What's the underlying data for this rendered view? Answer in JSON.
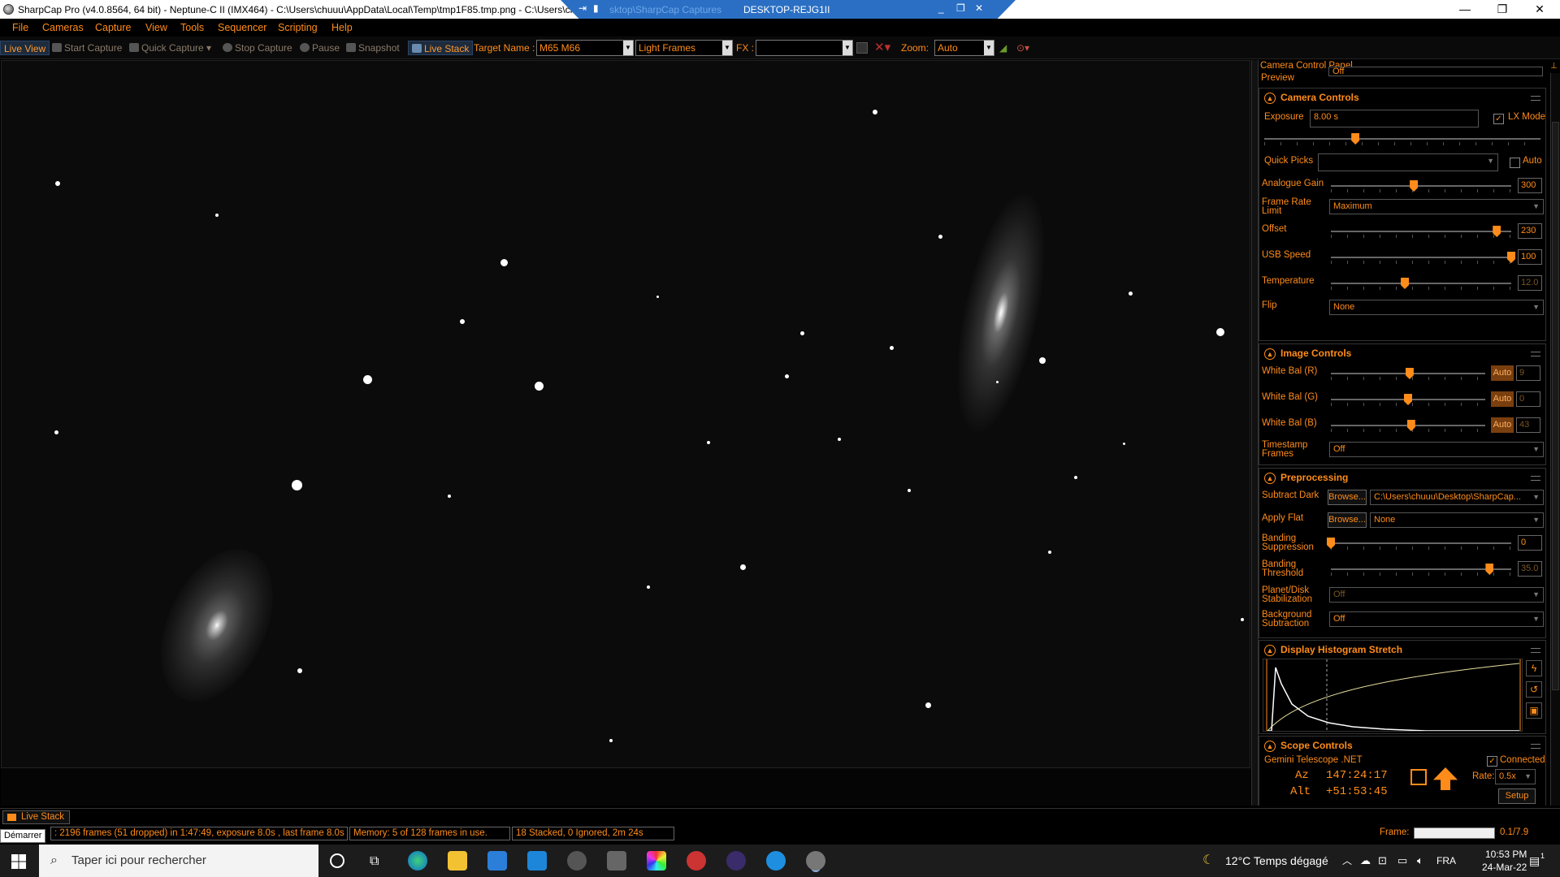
{
  "window": {
    "title": "SharpCap Pro (v4.0.8564, 64 bit) - Neptune-C II (IMX464) - C:\\Users\\chuuu\\AppData\\Local\\Temp\\tmp1F85.tmp.png - C:\\Users\\ch",
    "remote_title": "DESKTOP-REJG1II",
    "remote_faded": "sktop\\SharpCap Captures"
  },
  "menu": [
    "File",
    "Cameras",
    "Capture",
    "View",
    "Tools",
    "Sequencer",
    "Scripting",
    "Help"
  ],
  "toolbar": {
    "live_view": "Live View",
    "start_capture": "Start Capture",
    "quick_capture": "Quick Capture",
    "stop_capture": "Stop Capture",
    "pause": "Pause",
    "snapshot": "Snapshot",
    "live_stack": "Live Stack",
    "target_name_label": "Target Name :",
    "target_name_value": "M65 M66",
    "frame_type": "Light Frames",
    "fx_label": "FX :",
    "fx_value": "",
    "zoom_label": "Zoom:",
    "zoom_value": "Auto"
  },
  "panel": {
    "title": "Camera Control Panel",
    "preview_label": "Preview",
    "preview_value": "Off",
    "camera_controls": {
      "header": "Camera Controls",
      "exposure_label": "Exposure",
      "exposure_value": "8.00 s",
      "lx_mode_label": "LX Mode",
      "lx_mode_checked": true,
      "exposure_slider": 0.33,
      "quick_picks_label": "Quick Picks",
      "quick_picks_value": "",
      "auto_label": "Auto",
      "analogue_gain_label": "Analogue Gain",
      "analogue_gain_value": "300",
      "analogue_gain_slider": 0.46,
      "frame_rate_label": "Frame Rate Limit",
      "frame_rate_value": "Maximum",
      "offset_label": "Offset",
      "offset_value": "230",
      "offset_slider": 0.92,
      "usb_speed_label": "USB Speed",
      "usb_speed_value": "100",
      "usb_speed_slider": 1.0,
      "temperature_label": "Temperature",
      "temperature_value": "12.0",
      "temperature_slider": 0.41,
      "flip_label": "Flip",
      "flip_value": "None"
    },
    "image_controls": {
      "header": "Image Controls",
      "wb_r_label": "White Bal (R)",
      "wb_r_value": "9",
      "wb_r_slider": 0.51,
      "wb_g_label": "White Bal (G)",
      "wb_g_value": "0",
      "wb_g_slider": 0.5,
      "wb_b_label": "White Bal (B)",
      "wb_b_value": "43",
      "wb_b_slider": 0.52,
      "auto_label": "Auto",
      "timestamp_label": "Timestamp Frames",
      "timestamp_value": "Off"
    },
    "preprocessing": {
      "header": "Preprocessing",
      "subtract_dark_label": "Subtract Dark",
      "browse_label": "Browse...",
      "subtract_dark_value": "C:\\Users\\chuuu\\Desktop\\SharpCap...",
      "apply_flat_label": "Apply Flat",
      "apply_flat_value": "None",
      "banding_supp_label": "Banding Suppression",
      "banding_supp_value": "0",
      "banding_supp_slider": 0.0,
      "banding_thresh_label": "Banding Threshold",
      "banding_thresh_value": "35.0",
      "banding_thresh_slider": 0.88,
      "planet_label": "Planet/Disk Stabilization",
      "planet_value": "Off",
      "background_label": "Background Subtraction",
      "background_value": "Off"
    },
    "histogram": {
      "header": "Display Histogram Stretch"
    },
    "scope": {
      "header": "Scope Controls",
      "mount_name": "Gemini Telescope .NET",
      "connected_label": "Connected",
      "connected": true,
      "az_label": "Az",
      "az_value": "147:24:17",
      "alt_label": "Alt",
      "alt_value": "+51:53:45",
      "rate_label": "Rate:",
      "rate_value": "0.5x",
      "setup_label": "Setup"
    }
  },
  "tab": {
    "live_stack": "Live Stack"
  },
  "status": {
    "tooltip": "Démarrer",
    "frames": ": 2196 frames (51 dropped) in 1:47:49, exposure 8.0s , last frame 8.0s",
    "memory": "Memory: 5 of 128 frames in use.",
    "stacked": "18 Stacked, 0 Ignored, 2m 24s",
    "frame_label": "Frame:",
    "frame_value": "0.1/7.9"
  },
  "taskbar": {
    "search_placeholder": "Taper ici pour rechercher",
    "weather": "12°C  Temps dégagé",
    "language": "FRA",
    "time": "10:53 PM",
    "date": "24-Mar-22",
    "notifications": "1"
  },
  "colors": {
    "accent": "#ff8c1a",
    "background": "#000000",
    "titlebar": "#ffffff",
    "remote_bar": "#2a6fc4",
    "taskbar": "#1c1c1c"
  }
}
